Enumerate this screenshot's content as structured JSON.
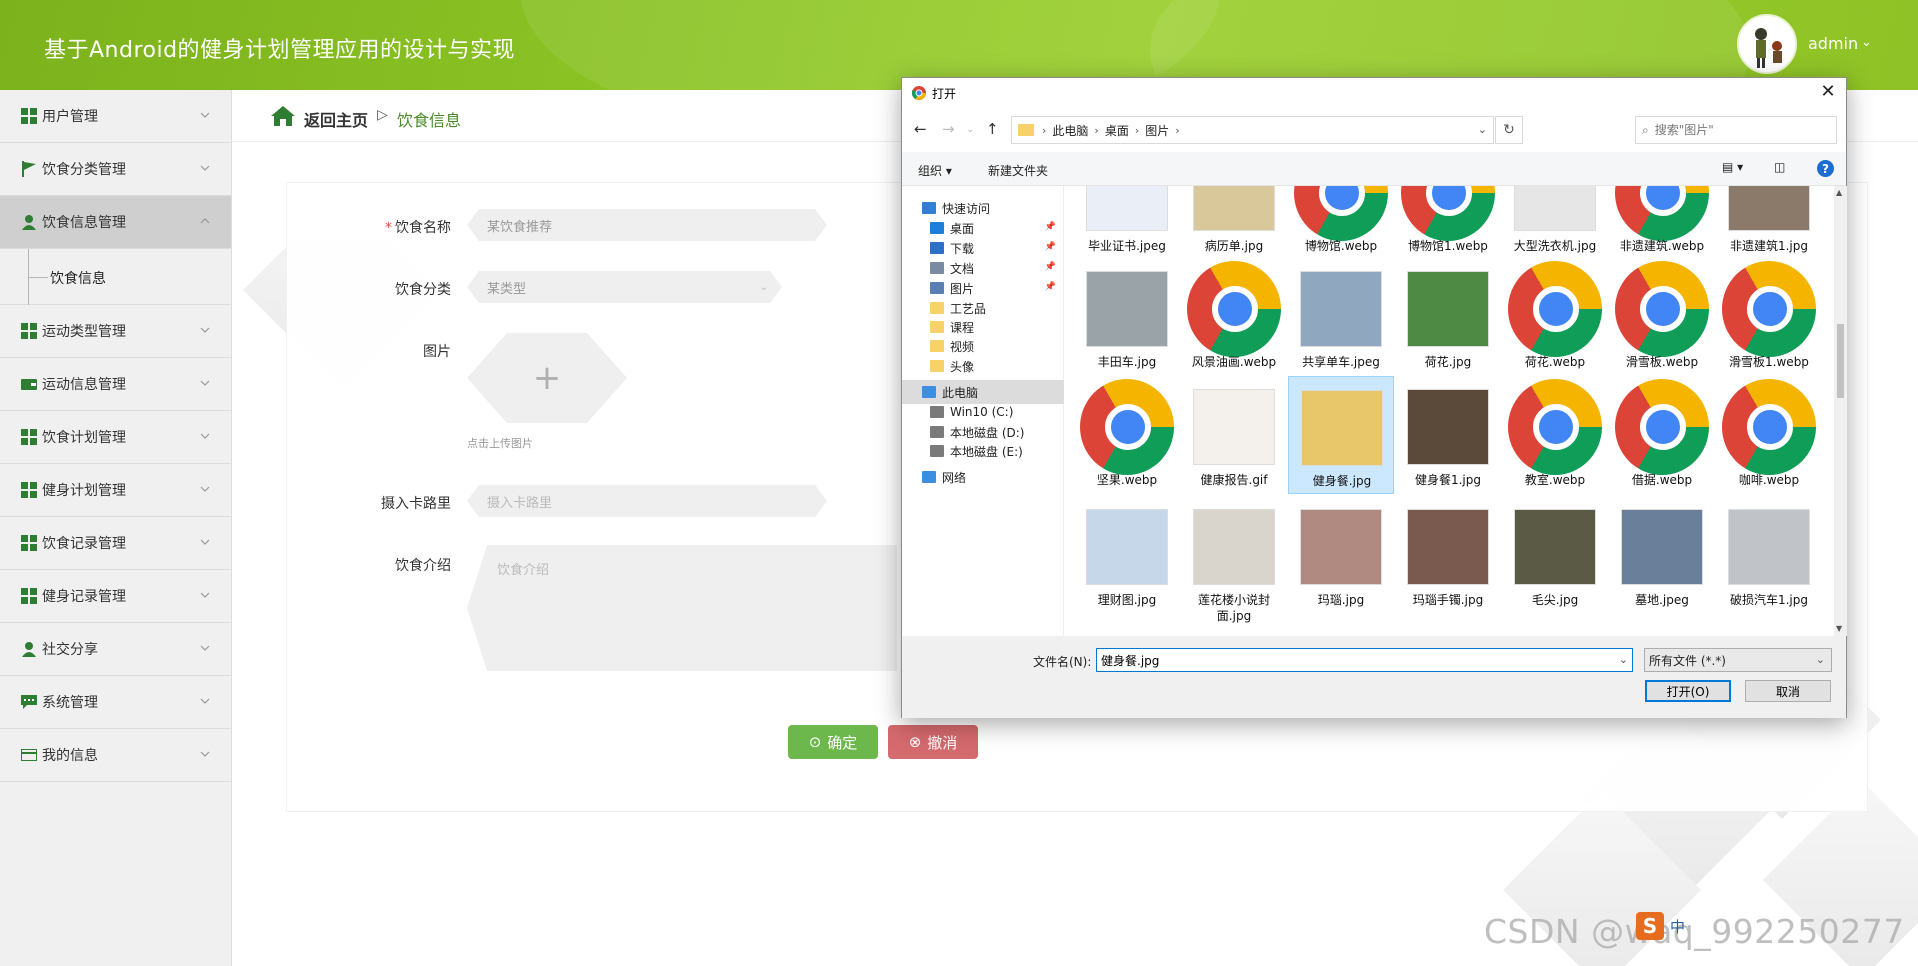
{
  "header": {
    "title": "基于Android的健身计划管理应用的设计与实现",
    "user_name": "admin",
    "caret": "⌄"
  },
  "sidebar": {
    "items": [
      {
        "label": "用户管理",
        "icon": "grid-icon"
      },
      {
        "label": "饮食分类管理",
        "icon": "flag-icon"
      },
      {
        "label": "饮食信息管理",
        "icon": "user-icon",
        "active": true
      },
      {
        "label": "运动类型管理",
        "icon": "grid-icon"
      },
      {
        "label": "运动信息管理",
        "icon": "wallet-icon"
      },
      {
        "label": "饮食计划管理",
        "icon": "grid-icon"
      },
      {
        "label": "健身计划管理",
        "icon": "grid-icon"
      },
      {
        "label": "饮食记录管理",
        "icon": "grid-icon"
      },
      {
        "label": "健身记录管理",
        "icon": "grid-icon"
      },
      {
        "label": "社交分享",
        "icon": "user-icon"
      },
      {
        "label": "系统管理",
        "icon": "chat-icon"
      },
      {
        "label": "我的信息",
        "icon": "card-icon"
      }
    ],
    "submenu_label": "饮食信息"
  },
  "breadcrumb": {
    "home": "返回主页",
    "sep": "▷",
    "current": "饮食信息"
  },
  "form": {
    "name_label": "饮食名称",
    "name_required": "*",
    "name_value": "某饮食推荐",
    "category_label": "饮食分类",
    "category_value": "某类型",
    "image_label": "图片",
    "upload_plus": "+",
    "upload_hint": "点击上传图片",
    "calories_label": "摄入卡路里",
    "calories_placeholder": "摄入卡路里",
    "intro_label": "饮食介绍",
    "intro_placeholder": "饮食介绍",
    "ok_label": "确定",
    "cancel_label": "撤消"
  },
  "dialog": {
    "title": "打开",
    "close": "✕",
    "path": [
      "此电脑",
      "桌面",
      "图片"
    ],
    "search_placeholder": "搜索\"图片\"",
    "organize": "组织 ▾",
    "new_folder": "新建文件夹",
    "help": "?",
    "nav_items": [
      {
        "label": "快速访问",
        "color": "#2f7fd6"
      },
      {
        "label": "桌面",
        "color": "#1e7fd8",
        "pinned": true
      },
      {
        "label": "下载",
        "color": "#2b6fc6",
        "pinned": true
      },
      {
        "label": "文档",
        "color": "#7a8aa0",
        "pinned": true
      },
      {
        "label": "图片",
        "color": "#5a7fb3",
        "pinned": true
      },
      {
        "label": "工艺品",
        "color": "#f7d26a"
      },
      {
        "label": "课程",
        "color": "#f7d26a"
      },
      {
        "label": "视频",
        "color": "#f7d26a"
      },
      {
        "label": "头像",
        "color": "#f7d26a"
      },
      {
        "label": "此电脑",
        "color": "#3b8ee0",
        "selected": true
      },
      {
        "label": "Win10 (C:)",
        "color": "#7a7a7a"
      },
      {
        "label": "本地磁盘 (D:)",
        "color": "#7a7a7a"
      },
      {
        "label": "本地磁盘 (E:)",
        "color": "#7a7a7a"
      },
      {
        "label": "网络",
        "color": "#3b8ee0"
      }
    ],
    "files": [
      {
        "name": "毕业证书.jpeg",
        "kind": "photo",
        "tone": "#e9eef7"
      },
      {
        "name": "病历单.jpg",
        "kind": "photo",
        "tone": "#d9c99a"
      },
      {
        "name": "博物馆.webp",
        "kind": "chrome"
      },
      {
        "name": "博物馆1.webp",
        "kind": "chrome"
      },
      {
        "name": "大型洗衣机.jpg",
        "kind": "photo",
        "tone": "#e6e6e6"
      },
      {
        "name": "非遗建筑.webp",
        "kind": "chrome"
      },
      {
        "name": "非遗建筑1.jpg",
        "kind": "photo",
        "tone": "#8b7a6a"
      },
      {
        "name": "丰田车.jpg",
        "kind": "photo",
        "tone": "#9aa3a8"
      },
      {
        "name": "风景油画.webp",
        "kind": "chrome"
      },
      {
        "name": "共享单车.jpeg",
        "kind": "photo",
        "tone": "#8fa8bf"
      },
      {
        "name": "荷花.jpg",
        "kind": "photo",
        "tone": "#4f8a45"
      },
      {
        "name": "荷花.webp",
        "kind": "chrome"
      },
      {
        "name": "滑雪板.webp",
        "kind": "chrome"
      },
      {
        "name": "滑雪板1.webp",
        "kind": "chrome"
      },
      {
        "name": "坚果.webp",
        "kind": "chrome"
      },
      {
        "name": "健康报告.gif",
        "kind": "photo",
        "tone": "#f4f0ec"
      },
      {
        "name": "健身餐.jpg",
        "kind": "photo",
        "tone": "#e8c66a",
        "selected": true
      },
      {
        "name": "健身餐1.jpg",
        "kind": "photo",
        "tone": "#5b4a3a"
      },
      {
        "name": "教室.webp",
        "kind": "chrome"
      },
      {
        "name": "借据.webp",
        "kind": "chrome"
      },
      {
        "name": "咖啡.webp",
        "kind": "chrome"
      },
      {
        "name": "理财图.jpg",
        "kind": "photo",
        "tone": "#c6d7ea"
      },
      {
        "name": "莲花楼小说封面.jpg",
        "kind": "photo",
        "tone": "#d9d4cc"
      },
      {
        "name": "玛瑙.jpg",
        "kind": "photo",
        "tone": "#b08a80"
      },
      {
        "name": "玛瑙手镯.jpg",
        "kind": "photo",
        "tone": "#7a5a4e"
      },
      {
        "name": "毛尖.jpg",
        "kind": "photo",
        "tone": "#5a5a45"
      },
      {
        "name": "墓地.jpeg",
        "kind": "photo",
        "tone": "#6a7f9a"
      },
      {
        "name": "破损汽车1.jpg",
        "kind": "photo",
        "tone": "#c0c4c8"
      }
    ],
    "filename_label": "文件名(N):",
    "filename_value": "健身餐.jpg",
    "filetype_value": "所有文件 (*.*)",
    "open_label": "打开(O)",
    "cancel_label": "取消"
  },
  "watermark": "CSDN @waq_992250277",
  "tray": {
    "ime": "中"
  }
}
